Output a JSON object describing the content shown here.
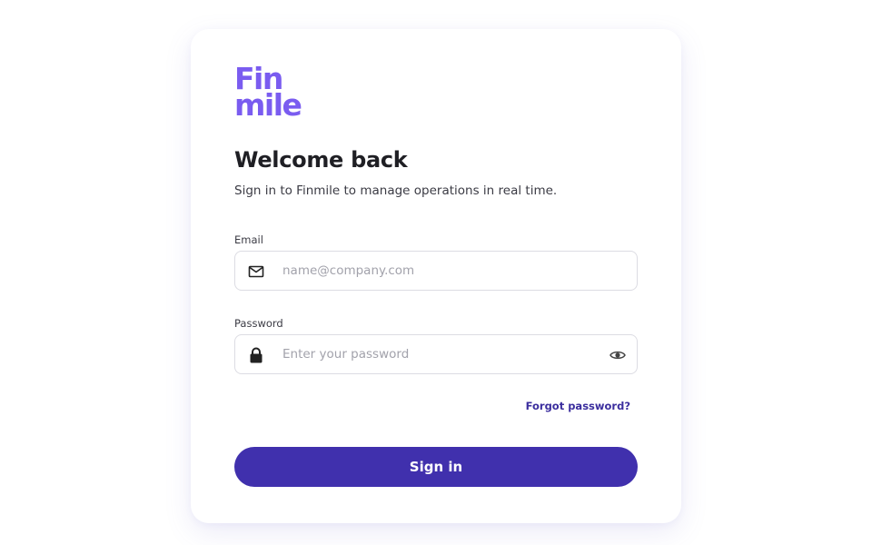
{
  "brand": {
    "logo_line1": "Fin",
    "logo_line2": "mile",
    "color": "#7a5cf0"
  },
  "heading": {
    "title": "Welcome back",
    "subtitle": "Sign in to Finmile to manage operations in real time."
  },
  "form": {
    "email": {
      "label": "Email",
      "placeholder": "name@company.com",
      "value": "",
      "icon": "mail-icon"
    },
    "password": {
      "label": "Password",
      "placeholder": "Enter your password",
      "value": "",
      "icon": "lock-icon",
      "toggle_icon": "eye-icon"
    },
    "forgot_label": "Forgot password?",
    "submit_label": "Sign in"
  },
  "colors": {
    "primary": "#4030ad",
    "link": "#3b2e9e",
    "brand": "#7a5cf0"
  }
}
